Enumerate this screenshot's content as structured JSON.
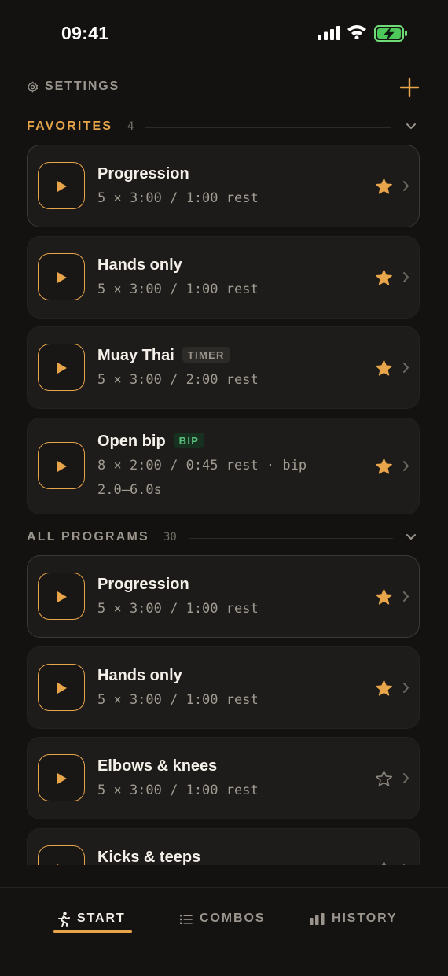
{
  "status_bar": {
    "time": "09:41"
  },
  "header": {
    "settings_label": "SETTINGS"
  },
  "favorites": {
    "title": "FAVORITES",
    "count": "4",
    "items": [
      {
        "title": "Progression",
        "badge": "",
        "subtitle": "5 × 3:00 / 1:00 rest",
        "favorite": true
      },
      {
        "title": "Hands only",
        "badge": "",
        "subtitle": "5 × 3:00 / 1:00 rest",
        "favorite": true
      },
      {
        "title": "Muay Thai",
        "badge": "TIMER",
        "subtitle": "5 × 3:00 / 2:00 rest",
        "favorite": true
      },
      {
        "title": "Open bip",
        "badge": "BIP",
        "subtitle": "8 × 2:00 / 0:45 rest · bip 2.0–6.0s",
        "favorite": true
      }
    ]
  },
  "all_programs": {
    "title": "ALL PROGRAMS",
    "count": "30",
    "items": [
      {
        "title": "Progression",
        "subtitle": "5 × 3:00 / 1:00 rest",
        "favorite": true
      },
      {
        "title": "Hands only",
        "subtitle": "5 × 3:00 / 1:00 rest",
        "favorite": true
      },
      {
        "title": "Elbows & knees",
        "subtitle": "5 × 3:00 / 1:00 rest",
        "favorite": false
      },
      {
        "title": "Kicks & teeps",
        "subtitle": "",
        "favorite": false
      }
    ]
  },
  "tab_bar": {
    "tabs": [
      {
        "label": "START",
        "icon": "runner-icon",
        "active": true
      },
      {
        "label": "COMBOS",
        "icon": "list-icon",
        "active": false
      },
      {
        "label": "HISTORY",
        "icon": "bar-chart-icon",
        "active": false
      }
    ]
  },
  "colors": {
    "accent": "#e8a54a",
    "background": "#131211",
    "card": "#1d1c1a",
    "muted_text": "#a19b92",
    "bip_green": "#5ac37d"
  }
}
